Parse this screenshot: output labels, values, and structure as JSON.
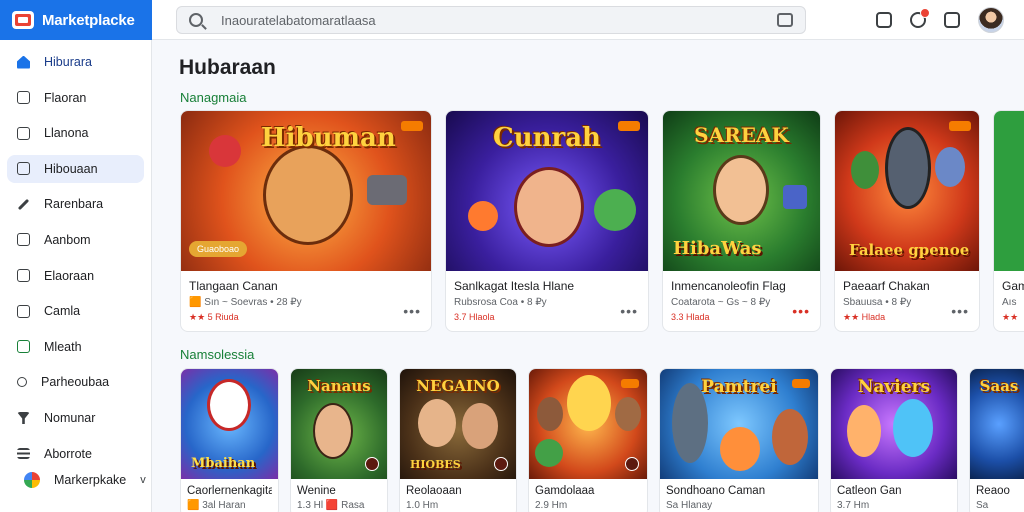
{
  "app": {
    "name": "Marketplacke"
  },
  "search": {
    "placeholder": "Inaouratelabatomaratlaasa"
  },
  "sidebar": {
    "items": [
      {
        "label": "Hiburara",
        "icon": "home-icon"
      },
      {
        "label": "Flaoran",
        "icon": "box-icon"
      },
      {
        "label": "Llanona",
        "icon": "house-icon"
      },
      {
        "label": "Hibouaan",
        "icon": "checkbox-icon"
      },
      {
        "label": "Rarenbara",
        "icon": "pen-icon"
      },
      {
        "label": "Aanbom",
        "icon": "check-icon"
      },
      {
        "label": "Elaoraan",
        "icon": "document-icon"
      },
      {
        "label": "Camla",
        "icon": "bag-icon"
      },
      {
        "label": "Mleath",
        "icon": "check-icon"
      },
      {
        "label": "Parheoubaa",
        "icon": "key-icon"
      },
      {
        "label": "Nomunar",
        "icon": "funnel-icon"
      },
      {
        "label": "Aborrote",
        "icon": "list-icon"
      }
    ],
    "footer": {
      "label": "Markerpkake"
    }
  },
  "main": {
    "title": "Hubaraan",
    "sections": [
      {
        "title": "Nanagmaia",
        "cards": [
          {
            "art_title": "Hibuman",
            "pill": "Guaoboao",
            "name": "Tlangaan Canan",
            "sub": "🟧 Sın  ~  Soevras •  28 ₽y",
            "rate": "★★ 5 Riuda"
          },
          {
            "art_title": "Cunrah",
            "name": "Sanlkagat Itesla Hlane",
            "sub": "Rubsrosa Coa  •  8 ₽y",
            "rate": "3.7 Hlaola"
          },
          {
            "art_title": "SAREAK",
            "art_bottom": "HibaWas",
            "name": "Inmencanoleofin Flag",
            "sub": "Coatarota ~  Gs  ~  8 ₽y",
            "rate": "3.3 Hlada"
          },
          {
            "art_title": "",
            "art_bottom": "Falaee gpenoe",
            "name": "Paeaarf Chakan",
            "sub": "Sbauusa  •  8 ₽y",
            "rate": "★★ Hlada"
          },
          {
            "art_title": "",
            "name": "Gam",
            "sub": "Aıs",
            "rate": "★★"
          }
        ]
      },
      {
        "title": "Namsolessia",
        "cards": [
          {
            "art_title": "",
            "art_bottom": "Mbaihan",
            "name": "Caorlernenkagita",
            "sub": "🟧 3al Haran"
          },
          {
            "art_title": "Nanaus",
            "name": "Wenine",
            "sub": "1.3 Hl  🟥 Rasa"
          },
          {
            "art_title": "NEGAINO",
            "art_bottom": "HIOBES",
            "name": "Reolaoaan",
            "sub": "1.0 Hm"
          },
          {
            "art_title": "",
            "name": "Gamdolaaa",
            "sub": "2.9 Hm"
          },
          {
            "art_title": "Pamtrei",
            "name": "Sondhoano Caman",
            "sub": "Sa Hlanay"
          },
          {
            "art_title": "Naviers",
            "name": "Catleon Gan",
            "sub": "3.7 Hm"
          },
          {
            "art_title": "Saas",
            "name": "Reaoo",
            "sub": "Sa"
          }
        ]
      }
    ]
  },
  "colors": {
    "brand": "#1a73e8",
    "section_title": "#188038",
    "accent": "#f57c00"
  }
}
